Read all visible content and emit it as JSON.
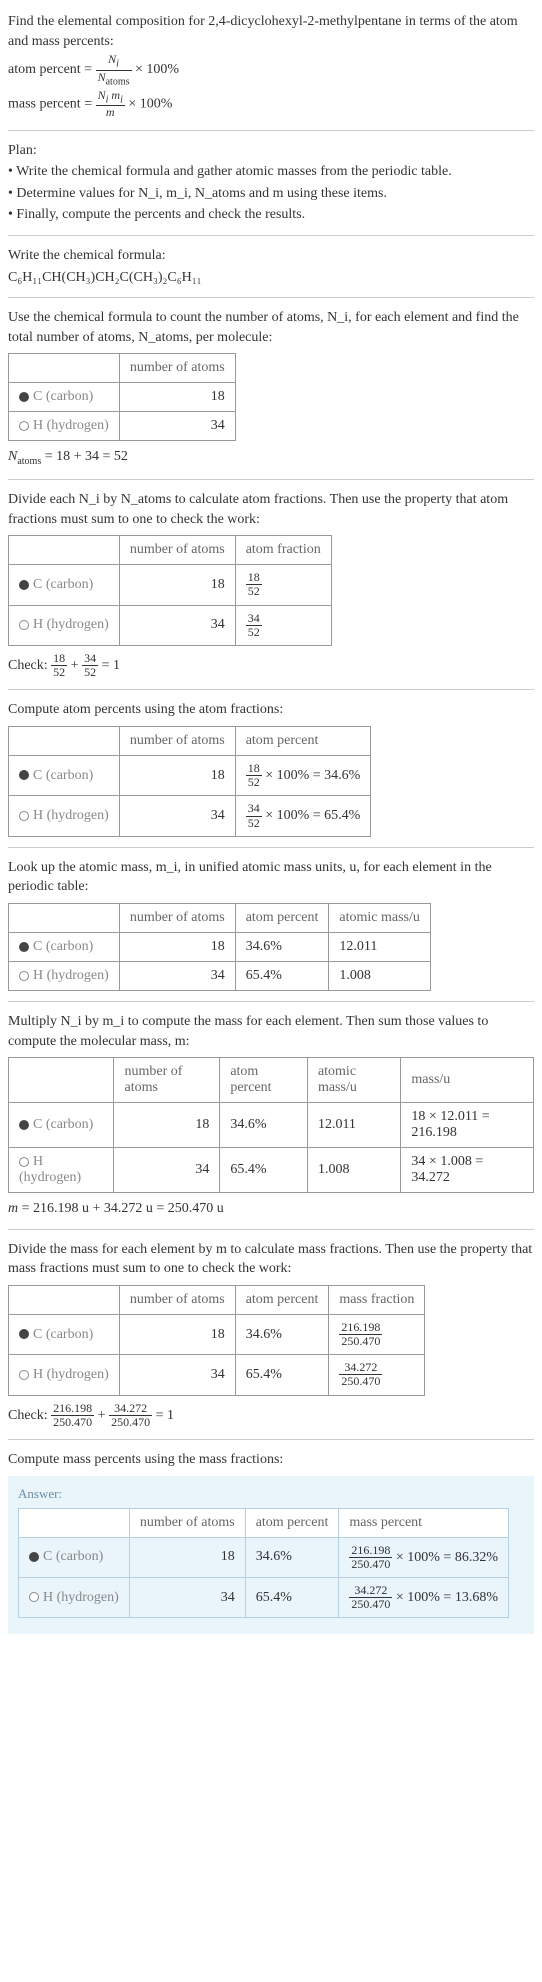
{
  "intro": {
    "text1": "Find the elemental composition for 2,4-dicyclohexyl-2-methylpentane in terms of the atom and mass percents:",
    "atom_percent_lhs": "atom percent =",
    "atom_percent_num": "N_i",
    "atom_percent_den": "N_atoms",
    "mass_percent_lhs": "mass percent =",
    "mass_percent_num": "N_i m_i",
    "mass_percent_den": "m",
    "times100": "× 100%"
  },
  "plan": {
    "heading": "Plan:",
    "b1": "• Write the chemical formula and gather atomic masses from the periodic table.",
    "b2": "• Determine values for N_i, m_i, N_atoms and m using these items.",
    "b3": "• Finally, compute the percents and check the results."
  },
  "formula_section": {
    "heading": "Write the chemical formula:",
    "formula": "C₆H₁₁CH(CH₃)CH₂C(CH₃)₂C₆H₁₁"
  },
  "count_section": {
    "text": "Use the chemical formula to count the number of atoms, N_i, for each element and find the total number of atoms, N_atoms, per molecule:",
    "col_atoms": "number of atoms",
    "c_label": "C (carbon)",
    "h_label": "H (hydrogen)",
    "c_n": "18",
    "h_n": "34",
    "sum_line": "N_atoms = 18 + 34 = 52"
  },
  "atomfrac_section": {
    "text": "Divide each N_i by N_atoms to calculate atom fractions. Then use the property that atom fractions must sum to one to check the work:",
    "col_atoms": "number of atoms",
    "col_frac": "atom fraction",
    "c_frac_num": "18",
    "c_frac_den": "52",
    "h_frac_num": "34",
    "h_frac_den": "52",
    "check_lhs": "Check:",
    "check_eq": " = 1"
  },
  "atompct_section": {
    "text": "Compute atom percents using the atom fractions:",
    "col_pct": "atom percent",
    "c_pct_expr_rhs": "× 100% = 34.6%",
    "h_pct_expr_rhs": "× 100% = 65.4%"
  },
  "mass_section": {
    "text": "Look up the atomic mass, m_i, in unified atomic mass units, u, for each element in the periodic table:",
    "col_mass": "atomic mass/u",
    "c_pct": "34.6%",
    "h_pct": "65.4%",
    "c_mass": "12.011",
    "h_mass": "1.008"
  },
  "mult_section": {
    "text": "Multiply N_i by m_i to compute the mass for each element. Then sum those values to compute the molecular mass, m:",
    "col_massu": "mass/u",
    "c_mass_expr": "18 × 12.011 = 216.198",
    "h_mass_expr": "34 × 1.008 = 34.272",
    "m_line": "m = 216.198 u + 34.272 u = 250.470 u"
  },
  "massfrac_section": {
    "text": "Divide the mass for each element by m to calculate mass fractions. Then use the property that mass fractions must sum to one to check the work:",
    "col_mfrac": "mass fraction",
    "c_mfrac_num": "216.198",
    "c_mfrac_den": "250.470",
    "h_mfrac_num": "34.272",
    "h_mfrac_den": "250.470",
    "check_lhs": "Check:",
    "check_eq": " = 1"
  },
  "final_section": {
    "text": "Compute mass percents using the mass fractions:",
    "answer_label": "Answer:",
    "col_mpct": "mass percent",
    "c_mpct_rhs": "× 100% = 86.32%",
    "h_mpct_rhs": "× 100% = 13.68%"
  },
  "chart_data": {
    "type": "table",
    "title": "Elemental composition of 2,4-dicyclohexyl-2-methylpentane",
    "elements": [
      {
        "symbol": "C",
        "name": "carbon",
        "atoms": 18,
        "atom_percent": 34.6,
        "atomic_mass_u": 12.011,
        "mass_u": 216.198,
        "mass_percent": 86.32
      },
      {
        "symbol": "H",
        "name": "hydrogen",
        "atoms": 34,
        "atom_percent": 65.4,
        "atomic_mass_u": 1.008,
        "mass_u": 34.272,
        "mass_percent": 13.68
      }
    ],
    "N_atoms": 52,
    "molecular_mass_u": 250.47
  }
}
